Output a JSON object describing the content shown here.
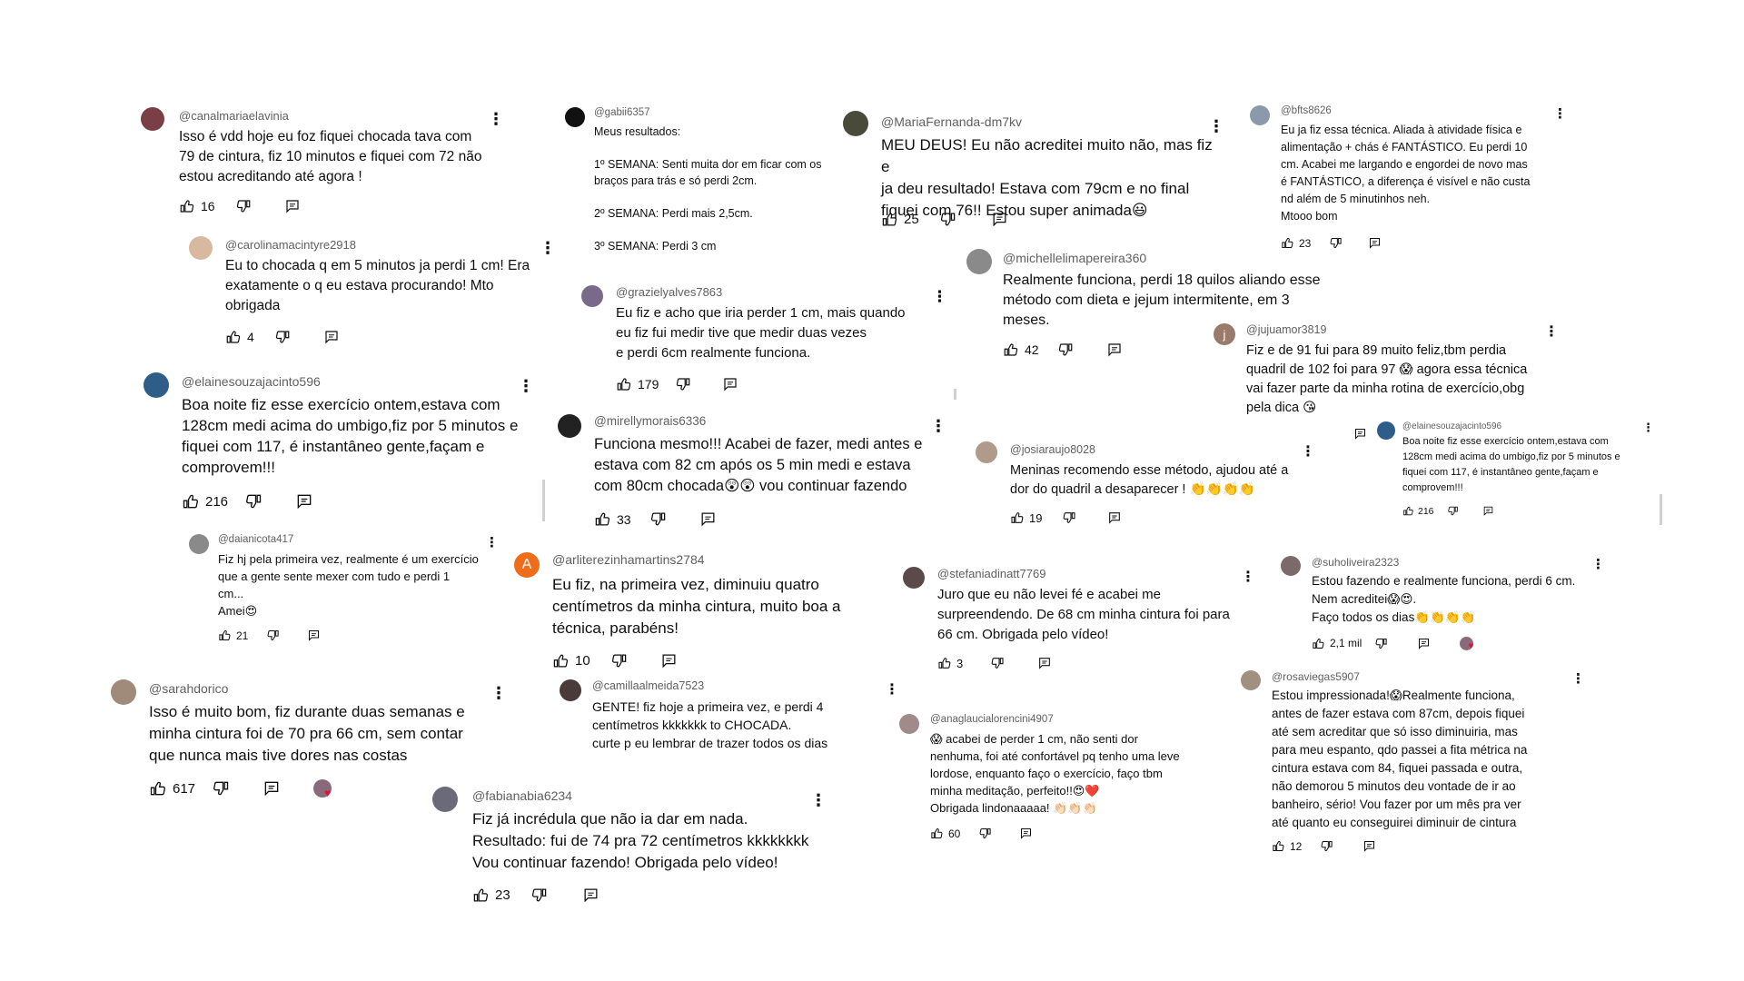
{
  "comments": [
    {
      "id": "c1",
      "handle": "@canalmariaelavinia",
      "avatar": {
        "color": "#7a3e46",
        "letter": ""
      },
      "text": "Isso é vdd hoje eu foz fiquei chocada tava com\n79 de cintura,  fiz 10 minutos e fiquei com 72 não\nestou acreditando até agora !",
      "likes": "16"
    },
    {
      "id": "c2",
      "handle": "@carolinamacintyre2918",
      "avatar": {
        "color": "#d9b8a0",
        "letter": ""
      },
      "text": "Eu to chocada q em 5 minutos ja perdi 1 cm! Era\nexatamente o q eu estava procurando! Mto\nobrigada",
      "likes": "4"
    },
    {
      "id": "c3",
      "handle": "@elainesouzajacinto596",
      "avatar": {
        "color": "#2f5d8a",
        "letter": ""
      },
      "text": "Boa noite fiz esse exercício ontem,estava com\n128cm medi acima do umbigo,fiz por 5 minutos e\nfiquei com 117, é instantâneo gente,façam e\ncomprovem!!!",
      "likes": "216"
    },
    {
      "id": "c4",
      "handle": "@daianicota417",
      "avatar": {
        "color": "#8a8a8a",
        "letter": ""
      },
      "text": "Fiz hj pela primeira vez, realmente é um exercício\nque a gente sente mexer com tudo e perdi 1\ncm...\nAmei😍",
      "likes": "21"
    },
    {
      "id": "c5",
      "handle": "@sarahdorico",
      "avatar": {
        "color": "#a08a7a",
        "letter": ""
      },
      "text": "Isso é muito bom, fiz durante duas semanas e\nminha cintura foi de 70 pra 66 cm, sem contar\nque nunca mais tive dores nas costas",
      "likes": "617"
    },
    {
      "id": "c6",
      "handle": "@gabii6357",
      "avatar": {
        "color": "#111111",
        "letter": ""
      },
      "text": "Meus resultados:\n\n1º SEMANA: Senti muita dor em ficar com os\nbraços para trás e só perdi 2cm.\n\n2º SEMANA: Perdi mais 2,5cm.\n\n3º SEMANA: Perdi 3 cm",
      "likes": ""
    },
    {
      "id": "c7",
      "handle": "@grazielyalves7863",
      "avatar": {
        "color": "#7a6a8a",
        "letter": ""
      },
      "text": "Eu fiz e acho que iria perder 1 cm,  mais quando\neu fiz fui medir tive que medir duas vezes\ne perdi 6cm  realmente funciona.",
      "likes": "179"
    },
    {
      "id": "c8",
      "handle": "@mirellymorais6336",
      "avatar": {
        "color": "#222222",
        "letter": ""
      },
      "text": "Funciona mesmo!!! Acabei de fazer, medi antes e\nestava com 82 cm após os 5 min medi e estava\ncom 80cm chocada😲😲 vou continuar fazendo",
      "likes": "33"
    },
    {
      "id": "c9",
      "handle": "@arliterezinhamartins2784",
      "avatar": {
        "color": "#ef6c1a",
        "letter": "A"
      },
      "text": "Eu fiz, na primeira vez, diminuiu quatro\ncentímetros da minha cintura, muito boa a\ntécnica, parabéns!",
      "likes": "10"
    },
    {
      "id": "c10",
      "handle": "@camillaalmeida7523",
      "avatar": {
        "color": "#4a3a3a",
        "letter": ""
      },
      "text": "GENTE! fiz hoje a primeira vez, e perdi 4\ncentímetros kkkkkkk to CHOCADA.\ncurte p eu lembrar de trazer todos os dias",
      "likes": ""
    },
    {
      "id": "c11",
      "handle": "@fabianabia6234",
      "avatar": {
        "color": "#6a6a7a",
        "letter": ""
      },
      "text": "Fiz já incrédula que não ia dar em nada.\nResultado: fui de 74 pra 72 centímetros kkkkkkkk\nVou continuar fazendo! Obrigada pelo vídeo!",
      "likes": "23"
    },
    {
      "id": "c12",
      "handle": "@MariaFernanda-dm7kv",
      "avatar": {
        "color": "#4a4a3a",
        "letter": ""
      },
      "text": "MEU DEUS! Eu não acreditei muito não, mas fiz e\nja deu resultado! Estava com 79cm e no final\nfiquei com 76!! Estou super animada😃",
      "likes": "25"
    },
    {
      "id": "c13",
      "handle": "@michellelimapereira360",
      "avatar": {
        "color": "#8a8a8a",
        "letter": ""
      },
      "text": "Realmente funciona, perdi 18 quilos aliando esse\nmétodo com dieta e jejum intermitente, em 3\nmeses.",
      "likes": "42"
    },
    {
      "id": "c14",
      "handle": "@josiaraujo8028",
      "avatar": {
        "color": "#b09a8a",
        "letter": ""
      },
      "text": "Meninas recomendo esse método, ajudou até a\ndor do quadril a desaparecer ! 👏👏👏👏",
      "likes": "19"
    },
    {
      "id": "c15",
      "handle": "@stefaniadinatt7769",
      "avatar": {
        "color": "#5a4a4a",
        "letter": ""
      },
      "text": "Juro que eu não levei fé e acabei me\nsurpreendendo. De 68 cm minha cintura foi para\n66 cm. Obrigada pelo vídeo!",
      "likes": "3"
    },
    {
      "id": "c16",
      "handle": "@anaglaucialorencini4907",
      "avatar": {
        "color": "#a08a8a",
        "letter": ""
      },
      "text": "😱 acabei de perder 1 cm, não senti dor\nnenhuma, foi até confortável pq tenho uma leve\nlordose, enquanto faço o exercício, faço tbm\nminha meditação, perfeito!!😍❤️\nObrigada lindonaaaaa! 👏🏻👏🏻👏🏻",
      "likes": "60"
    },
    {
      "id": "c17",
      "handle": "@bfts8626",
      "avatar": {
        "color": "#8a9aaa",
        "letter": ""
      },
      "text": "Eu ja fiz essa técnica. Aliada à atividade física e\nalimentação + chás é FANTÁSTICO. Eu perdi 10\ncm. Acabei me largando e engordei de novo mas\né FANTÁSTICO, a diferença é visível e não custa\nnd além de 5 minutinhos neh.\nMtooo bom",
      "likes": "23"
    },
    {
      "id": "c18",
      "handle": "@jujuamor3819",
      "avatar": {
        "color": "#9a7a6a",
        "letter": "j"
      },
      "text": "Fiz e de 91 fui para 89 muito feliz,tbm perdia\nquadril de 102 foi para 97 😱 agora essa técnica\nvai fazer parte da minha rotina de exercício,obg\npela dica 😘",
      "likes": ""
    },
    {
      "id": "c19",
      "handle": "@elainesouzajacinto596",
      "avatar": {
        "color": "#2f5d8a",
        "letter": ""
      },
      "text": "Boa noite fiz esse exercício ontem,estava com\n128cm medi acima do umbigo,fiz por 5 minutos e\nfiquei com 117, é instantâneo gente,façam e\ncomprovem!!!",
      "likes": "216"
    },
    {
      "id": "c20",
      "handle": "@suholiveira2323",
      "avatar": {
        "color": "#7a6a6a",
        "letter": ""
      },
      "text": "Estou fazendo e realmente funciona, perdi 6 cm.\nNem acreditei😱😍.\nFaço todos os dias👏👏👏👏",
      "likes": "2,1 mil"
    },
    {
      "id": "c21",
      "handle": "@rosaviegas5907",
      "avatar": {
        "color": "#a09080",
        "letter": ""
      },
      "text": "Estou impressionada!😱Realmente  funciona,\nantes de fazer estava com 87cm, depois fiquei\naté  sem acreditar que só isso diminuiria, mas\npara meu espanto, qdo passei a fita métrica na\ncintura estava com 84, fiquei passada e outra,\nnão demorou 5 minutos deu vontade de ir ao\nbanheiro, sério! Vou fazer por um mês  pra ver\naté  quanto eu conseguirei  diminuir de cintura",
      "likes": "12"
    }
  ]
}
